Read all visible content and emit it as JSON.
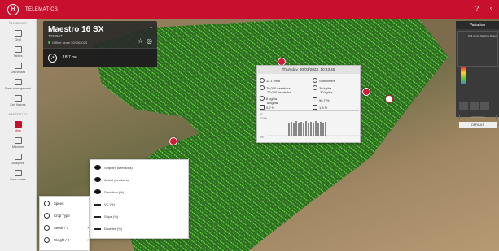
{
  "app": {
    "title": "TELEMATICS"
  },
  "sidebar": {
    "section_top": "DASHBOARD",
    "items": [
      {
        "label": "Grid"
      },
      {
        "label": "Tables"
      },
      {
        "label": "Dashboard"
      },
      {
        "label": "Fleet management"
      },
      {
        "label": "Key figures"
      }
    ],
    "section_mid": "MAESTRO SX",
    "items2": [
      {
        "label": "Map"
      },
      {
        "label": "Machine"
      },
      {
        "label": "Analytics"
      },
      {
        "label": "Error codes"
      }
    ]
  },
  "machine": {
    "name": "Maestro 16 SX",
    "id": "1234567",
    "status": "Offline since 30/03/2023",
    "area": "18.7 ha"
  },
  "popup": {
    "title": "Thursday, 30/03/2023, 10:43:45",
    "speed": "11.1 km/h",
    "status": "Sunflowers",
    "seeds_set": "70,000 seeds/ha",
    "seeds_act": "70,000 seeds/ha",
    "fert_set": "30 kg/ha",
    "fert_act": "30 kg/ha",
    "micro_set": "6 kg/ha",
    "micro_act": "6 kg/ha",
    "singulation": "96.7 %",
    "skips": "0.2 %",
    "doubles": "1.8 %",
    "row_label_1": "VC",
    "row_label_2": "92.8%",
    "row_label_3": "0%"
  },
  "variation_panel": {
    "title": "Variation",
    "legend_note": "Drill or Not Machine Below",
    "action_1": "AUTOSCALE",
    "action_2": "DEFAULT"
  },
  "layers": {
    "items": [
      {
        "label": "Setpoint (seeds/ha)"
      },
      {
        "label": "Actual (seeds/ha)"
      },
      {
        "label": "Deviation (%)"
      },
      {
        "label": "VC (%)"
      },
      {
        "label": "Skips (%)"
      },
      {
        "label": "Doubles (%)"
      }
    ]
  },
  "data_menu": {
    "items": [
      {
        "label": "Speed"
      },
      {
        "label": "Crop Type"
      },
      {
        "label": "Seeds / 1"
      },
      {
        "label": "Weight / 2"
      }
    ]
  },
  "colors": {
    "brand": "#c8102e",
    "pass": "#55d23a",
    "dark_pass": "#1f6b1a"
  }
}
